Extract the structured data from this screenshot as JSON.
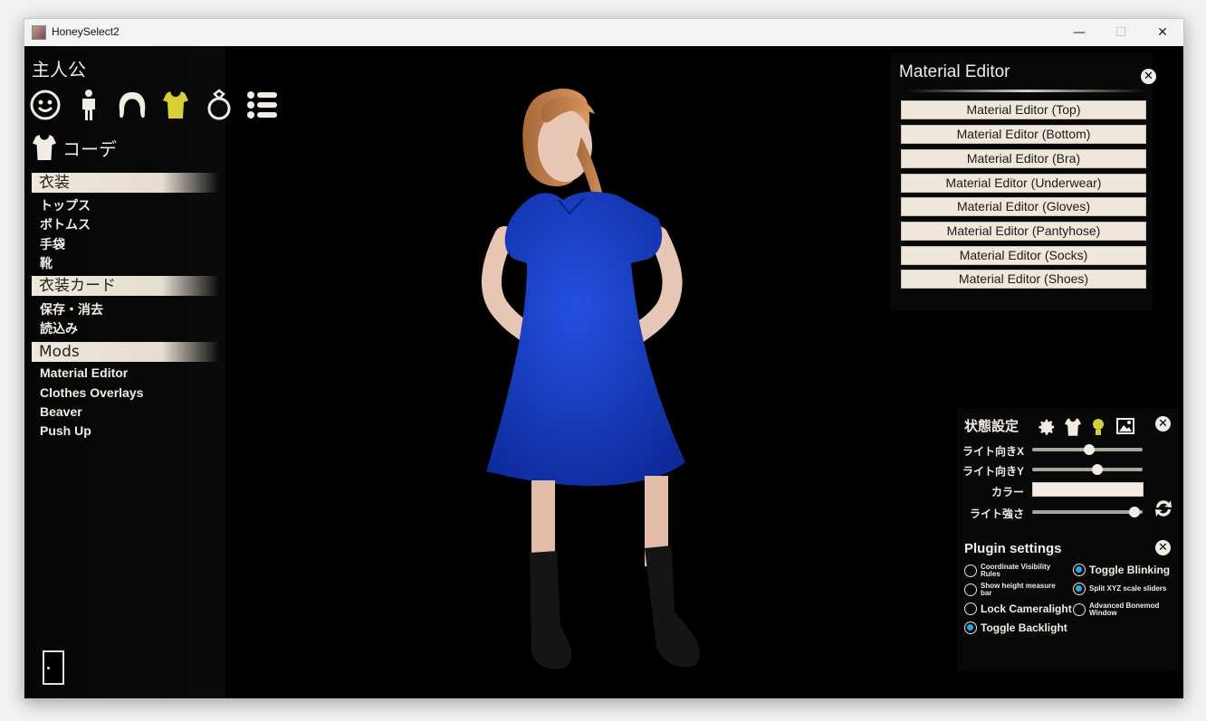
{
  "window": {
    "title": "HoneySelect2",
    "minimize_glyph": "—",
    "maximize_glyph": "☐",
    "close_glyph": "✕"
  },
  "left_panel": {
    "heading": "主人公",
    "categories": [
      {
        "icon": "face-icon"
      },
      {
        "icon": "body-icon"
      },
      {
        "icon": "hair-icon"
      },
      {
        "icon": "clothes-icon",
        "active_color": "#d6cf3a"
      },
      {
        "icon": "accessory-ring-icon"
      },
      {
        "icon": "list-icon"
      }
    ],
    "subheading": "コーデ",
    "sections": [
      {
        "title": "衣装",
        "items": [
          "トップス",
          "ボトムス",
          "手袋",
          "靴"
        ]
      },
      {
        "title": "衣装カード",
        "items": [
          "保存・消去",
          "読込み"
        ]
      },
      {
        "title": "Mods",
        "items": [
          "Material Editor",
          "Clothes Overlays",
          "Beaver",
          "Push Up"
        ]
      }
    ]
  },
  "material_editor": {
    "title": "Material Editor",
    "close_glyph": "✕",
    "buttons": [
      "Material Editor (Top)",
      "Material Editor (Bottom)",
      "Material Editor (Bra)",
      "Material Editor (Underwear)",
      "Material Editor (Gloves)",
      "Material Editor (Pantyhose)",
      "Material Editor (Socks)",
      "Material Editor (Shoes)"
    ]
  },
  "state_panel": {
    "title": "状態設定",
    "close_glyph": "✕",
    "light_x_label": "ライト向きX",
    "light_x_value": 0.52,
    "light_y_label": "ライト向きY",
    "light_y_value": 0.6,
    "color_label": "カラー",
    "color_value": "#f6ece6",
    "intensity_label": "ライト強さ",
    "intensity_value": 0.97
  },
  "plugin_settings": {
    "title": "Plugin settings",
    "close_glyph": "✕",
    "options": [
      {
        "label": "Coordinate Visibility Rules",
        "checked": false
      },
      {
        "label": "Toggle Blinking",
        "checked": true
      },
      {
        "label": "Show height measure bar",
        "checked": false
      },
      {
        "label": "Split XYZ scale sliders",
        "checked": true
      },
      {
        "label": "Lock Cameralight",
        "checked": false
      },
      {
        "label": "Advanced Bonemod Window",
        "checked": false
      },
      {
        "label": "Toggle Backlight",
        "checked": true
      }
    ]
  },
  "colors": {
    "accent_radio": "#2aa7e8",
    "dress": "#1a3fc4",
    "panel_text": "#f1ece4"
  }
}
